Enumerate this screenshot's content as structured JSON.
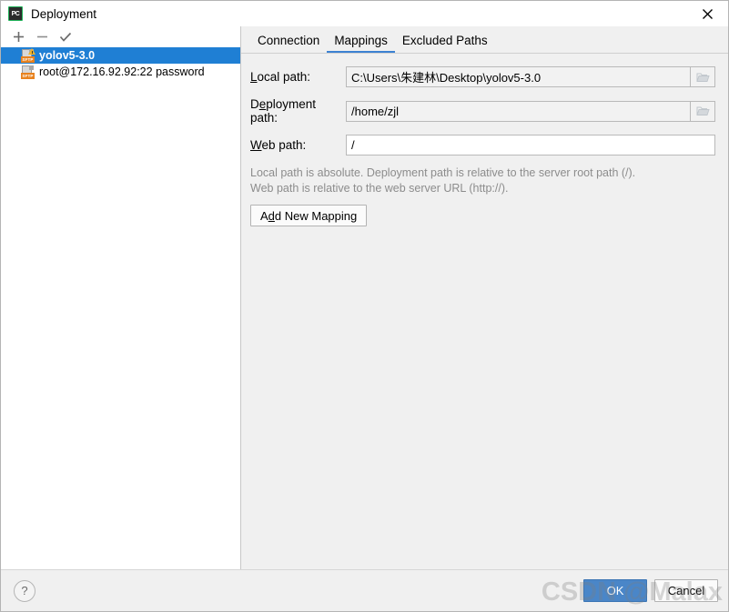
{
  "window": {
    "title": "Deployment",
    "app_icon": "pycharm-icon",
    "app_icon_text": "PC",
    "close_icon": "close-icon"
  },
  "left_panel": {
    "toolbar": [
      {
        "name": "add-server-button",
        "icon": "plus-icon"
      },
      {
        "name": "remove-server-button",
        "icon": "minus-icon"
      },
      {
        "name": "set-default-server-button",
        "icon": "check-icon"
      }
    ],
    "servers": [
      {
        "label": "yolov5-3.0",
        "icon": "sftp-warning-icon",
        "selected": true,
        "warning": true
      },
      {
        "label": "root@172.16.92.92:22 password",
        "icon": "sftp-icon",
        "selected": false,
        "warning": false
      }
    ]
  },
  "tabs": [
    {
      "label": "Connection",
      "active": false
    },
    {
      "label": "Mappings",
      "active": true
    },
    {
      "label": "Excluded Paths",
      "active": false
    }
  ],
  "form": {
    "local_path": {
      "label_prefix": "",
      "label_mnemonic": "L",
      "label_suffix": "ocal path:",
      "value": "C:\\Users\\朱建林\\Desktop\\yolov5-3.0",
      "placeholder": "",
      "browse_icon": "folder-icon"
    },
    "deployment_path": {
      "label_prefix": "D",
      "label_mnemonic": "e",
      "label_suffix": "ployment path:",
      "value": "/home/zjl",
      "placeholder": "",
      "browse_icon": "folder-icon"
    },
    "web_path": {
      "label_prefix": "",
      "label_mnemonic": "W",
      "label_suffix": "eb path:",
      "value": "/",
      "placeholder": ""
    },
    "hint_line1": "Local path is absolute. Deployment path is relative to the server root path (/).",
    "hint_line2": "Web path is relative to the web server URL (http://).",
    "add_mapping": {
      "prefix": "A",
      "mnemonic": "d",
      "suffix": "d New Mapping"
    }
  },
  "footer": {
    "help_label": "?",
    "ok_label": "OK",
    "cancel_label": "Cancel"
  },
  "watermark": {
    "text": "CSDN @Malax"
  },
  "colors": {
    "accent": "#1f7fd4",
    "tab_underline": "#3c82d2",
    "ok_button": "#4a86c8",
    "sftp_tag": "#e8821e",
    "panel_bg": "#f0f0f0",
    "list_bg": "#ffffff"
  }
}
